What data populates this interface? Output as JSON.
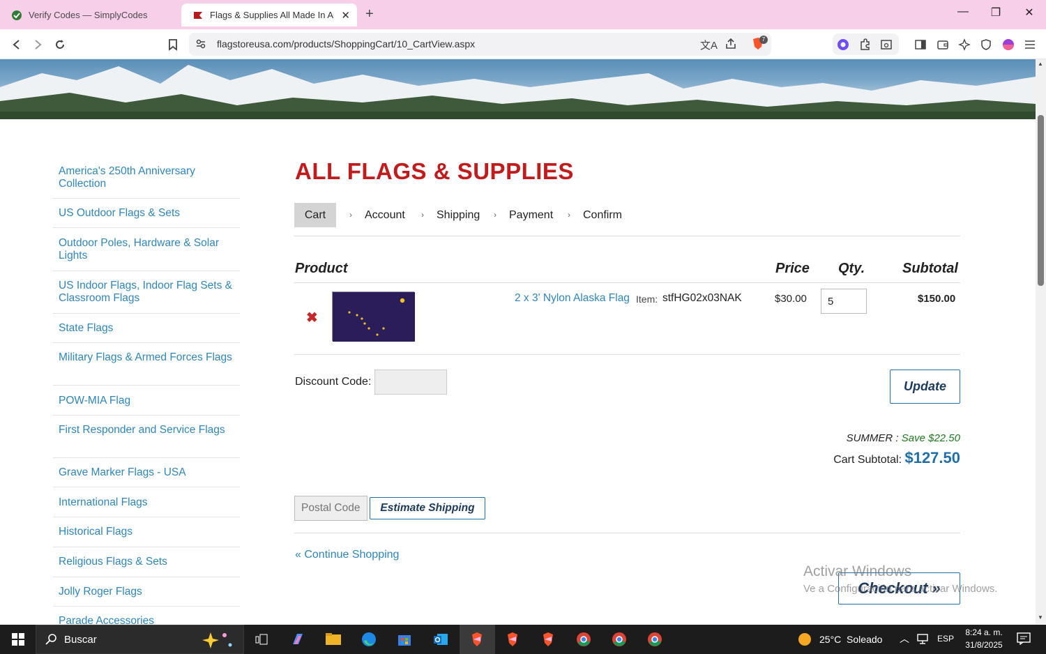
{
  "browser": {
    "tabs": [
      {
        "title": "Verify Codes — SimplyCodes"
      },
      {
        "title": "Flags & Supplies All Made In Am"
      }
    ],
    "url": "flagstoreusa.com/products/ShoppingCart/10_CartView.aspx",
    "shields_badge": "7"
  },
  "sidebar": {
    "items": [
      "America's 250th Anniversary Collection",
      "US Outdoor Flags & Sets",
      "Outdoor Poles, Hardware & Solar Lights",
      "US Indoor Flags, Indoor Flag Sets & Classroom Flags",
      "State Flags",
      "Military Flags & Armed Forces Flags",
      "POW-MIA Flag",
      "First Responder and Service Flags",
      "Grave Marker Flags - USA",
      "International Flags",
      "Historical Flags",
      "Religious Flags & Sets",
      "Jolly Roger Flags",
      "Parade Accessories"
    ]
  },
  "main": {
    "heading": "ALL FLAGS & SUPPLIES",
    "steps": [
      "Cart",
      "Account",
      "Shipping",
      "Payment",
      "Confirm"
    ],
    "columns": {
      "product": "Product",
      "price": "Price",
      "qty": "Qty.",
      "subtotal": "Subtotal"
    },
    "item": {
      "name": "2 x 3' Nylon Alaska Flag",
      "item_label": "Item:",
      "sku": "stfHG02x03NAK",
      "price": "$30.00",
      "qty": "5",
      "subtotal": "$150.00"
    },
    "discount_label": "Discount Code:",
    "update_label": "Update",
    "promo_code": "SUMMER",
    "promo_sep": " : ",
    "promo_save": "Save $22.50",
    "cart_subtotal_label": "Cart Subtotal:",
    "cart_subtotal": "$127.50",
    "postal_placeholder": "Postal Code",
    "estimate_label": "Estimate Shipping",
    "continue_label": "« Continue Shopping",
    "checkout_label": "Checkout »",
    "watermark_title": "Activar Windows",
    "watermark_sub": "Ve a Configuración para activar Windows."
  },
  "taskbar": {
    "search_label": "Buscar",
    "weather": "25°C  Soleado",
    "lang": "ESP",
    "time": "8:24 a. m.",
    "date": "31/8/2025"
  },
  "colors": {
    "accent_red": "#c11b1b",
    "link_blue": "#2f86b9",
    "price_blue": "#1f6fa8",
    "promo_green": "#1c7a1c",
    "tabstrip": "#f7cfe9"
  }
}
